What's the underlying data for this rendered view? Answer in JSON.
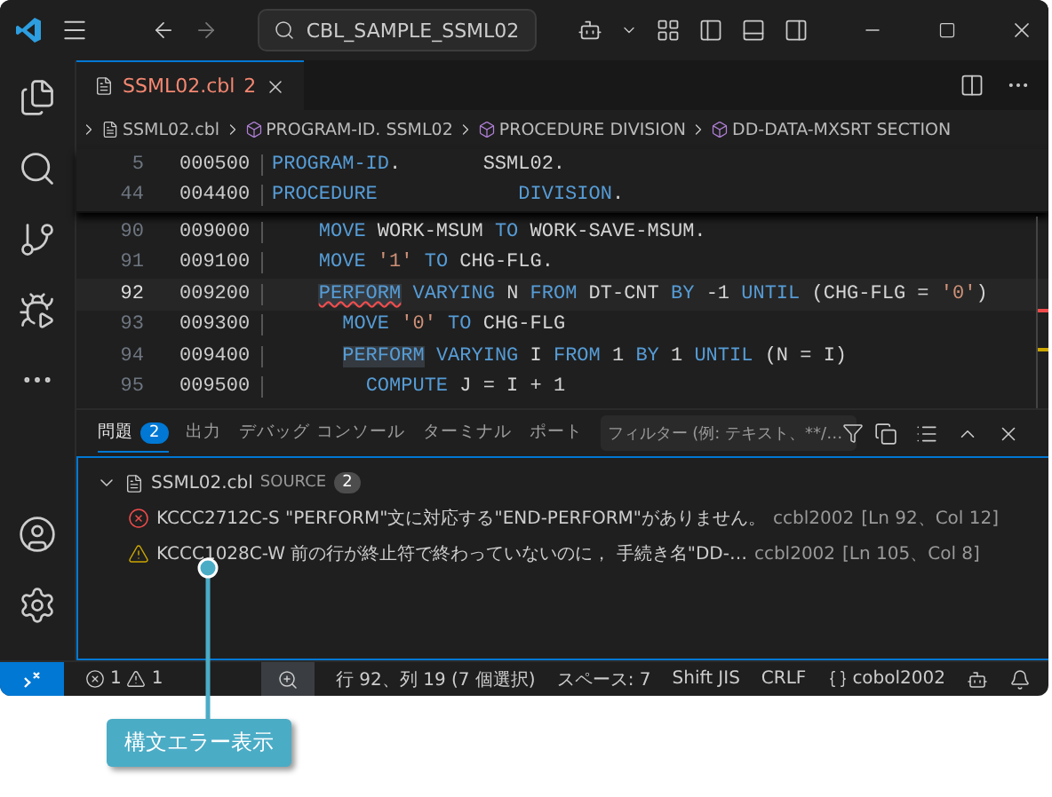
{
  "title_bar": {
    "search": "CBL_SAMPLE_SSML02"
  },
  "editor_tab": {
    "label": "SSML02.cbl",
    "problems": "2",
    "selected": true
  },
  "breadcrumbs": [
    {
      "kind": "file",
      "label": "SSML02.cbl"
    },
    {
      "kind": "symbol",
      "label": "PROGRAM-ID. SSML02"
    },
    {
      "kind": "symbol",
      "label": "PROCEDURE DIVISION"
    },
    {
      "kind": "symbol",
      "label": "DD-DATA-MXSRT SECTION"
    }
  ],
  "sticky_lines": [
    {
      "number": "5",
      "sequence": "000500",
      "current": false,
      "tokens": [
        {
          "kind": "keyword",
          "text": "PROGRAM-ID",
          "error": false,
          "highlighted": false
        },
        {
          "kind": "plain",
          "text": ".       SSML02.",
          "error": false,
          "highlighted": false
        }
      ]
    },
    {
      "number": "44",
      "sequence": "004400",
      "current": false,
      "tokens": [
        {
          "kind": "keyword",
          "text": "PROCEDURE",
          "error": false,
          "highlighted": false
        },
        {
          "kind": "keyword",
          "text": "            DIVISION",
          "error": false,
          "highlighted": false
        },
        {
          "kind": "plain",
          "text": ".",
          "error": false,
          "highlighted": false
        }
      ]
    }
  ],
  "code_lines": [
    {
      "number": "90",
      "sequence": "009000",
      "current": false,
      "tokens": [
        {
          "kind": "keyword",
          "text": "    MOVE",
          "error": false,
          "highlighted": false
        },
        {
          "kind": "plain",
          "text": " WORK-MSUM ",
          "error": false,
          "highlighted": false
        },
        {
          "kind": "keyword",
          "text": "TO",
          "error": false,
          "highlighted": false
        },
        {
          "kind": "plain",
          "text": " WORK-SAVE-MSUM.",
          "error": false,
          "highlighted": false
        }
      ]
    },
    {
      "number": "91",
      "sequence": "009100",
      "current": false,
      "tokens": [
        {
          "kind": "keyword",
          "text": "    MOVE",
          "error": false,
          "highlighted": false
        },
        {
          "kind": "string",
          "text": " '1'",
          "error": false,
          "highlighted": false
        },
        {
          "kind": "keyword",
          "text": " TO",
          "error": false,
          "highlighted": false
        },
        {
          "kind": "plain",
          "text": " CHG-FLG.",
          "error": false,
          "highlighted": false
        }
      ]
    },
    {
      "number": "92",
      "sequence": "009200",
      "current": true,
      "tokens": [
        {
          "kind": "keyword",
          "text": "    PERFORM",
          "error": true,
          "highlighted": true
        },
        {
          "kind": "keyword",
          "text": " VARYING",
          "error": false,
          "highlighted": false
        },
        {
          "kind": "plain",
          "text": " N ",
          "error": false,
          "highlighted": false
        },
        {
          "kind": "keyword",
          "text": "FROM",
          "error": false,
          "highlighted": false
        },
        {
          "kind": "plain",
          "text": " DT-CNT ",
          "error": false,
          "highlighted": false
        },
        {
          "kind": "keyword",
          "text": "BY",
          "error": false,
          "highlighted": false
        },
        {
          "kind": "plain",
          "text": " -1 ",
          "error": false,
          "highlighted": false
        },
        {
          "kind": "keyword",
          "text": "UNTIL",
          "error": false,
          "highlighted": false
        },
        {
          "kind": "plain",
          "text": " (CHG-FLG = ",
          "error": false,
          "highlighted": false
        },
        {
          "kind": "string",
          "text": "'0'",
          "error": false,
          "highlighted": false
        },
        {
          "kind": "plain",
          "text": ")",
          "error": false,
          "highlighted": false
        }
      ]
    },
    {
      "number": "93",
      "sequence": "009300",
      "current": false,
      "tokens": [
        {
          "kind": "keyword",
          "text": "      MOVE",
          "error": false,
          "highlighted": false
        },
        {
          "kind": "string",
          "text": " '0'",
          "error": false,
          "highlighted": false
        },
        {
          "kind": "keyword",
          "text": " TO",
          "error": false,
          "highlighted": false
        },
        {
          "kind": "plain",
          "text": " CHG-FLG",
          "error": false,
          "highlighted": false
        }
      ]
    },
    {
      "number": "94",
      "sequence": "009400",
      "current": false,
      "tokens": [
        {
          "kind": "keyword",
          "text": "      PERFORM",
          "error": false,
          "highlighted": true
        },
        {
          "kind": "keyword",
          "text": " VARYING",
          "error": false,
          "highlighted": false
        },
        {
          "kind": "plain",
          "text": " I ",
          "error": false,
          "highlighted": false
        },
        {
          "kind": "keyword",
          "text": "FROM",
          "error": false,
          "highlighted": false
        },
        {
          "kind": "plain",
          "text": " 1 ",
          "error": false,
          "highlighted": false
        },
        {
          "kind": "keyword",
          "text": "BY",
          "error": false,
          "highlighted": false
        },
        {
          "kind": "plain",
          "text": " 1 ",
          "error": false,
          "highlighted": false
        },
        {
          "kind": "keyword",
          "text": "UNTIL",
          "error": false,
          "highlighted": false
        },
        {
          "kind": "plain",
          "text": " (N = I)",
          "error": false,
          "highlighted": false
        }
      ]
    },
    {
      "number": "95",
      "sequence": "009500",
      "current": false,
      "tokens": [
        {
          "kind": "keyword",
          "text": "        COMPUTE",
          "error": false,
          "highlighted": false
        },
        {
          "kind": "plain",
          "text": " J = I + 1",
          "error": false,
          "highlighted": false
        }
      ]
    }
  ],
  "panel": {
    "tabs": [
      {
        "label": "問題",
        "badge": "2",
        "selected": true
      },
      {
        "label": "出力",
        "selected": false
      },
      {
        "label": "デバッグ コンソール",
        "selected": false
      },
      {
        "label": "ターミナル",
        "selected": false
      },
      {
        "label": "ポート",
        "selected": false
      }
    ],
    "filter": {
      "placeholder": "フィルター (例: テキスト、**/…"
    },
    "problems": [
      {
        "file": "SSML02.cbl",
        "folder": "SOURCE",
        "count": "2",
        "expanded": true,
        "children": [
          {
            "kind": "error",
            "message": "KCCC2712C-S \"PERFORM\"文に対応する\"END-PERFORM\"がありません。",
            "source": "ccbl2002",
            "location": "[Ln 92、Col 12]"
          },
          {
            "kind": "warning",
            "message": "KCCC1028C-W 前の行が終止符で終わっていないのに， 手続き名\"DD-…",
            "source": "ccbl2002",
            "location": "[Ln 105、Col 8]"
          }
        ]
      }
    ]
  },
  "status_bar": {
    "errors": "1",
    "warnings": "1",
    "position": "行 92、列 19 (7 個選択)",
    "indent": "スペース: 7",
    "encoding": "Shift JIS",
    "eol": "CRLF",
    "language": "cobol2002"
  },
  "callout": "構文エラー表示"
}
